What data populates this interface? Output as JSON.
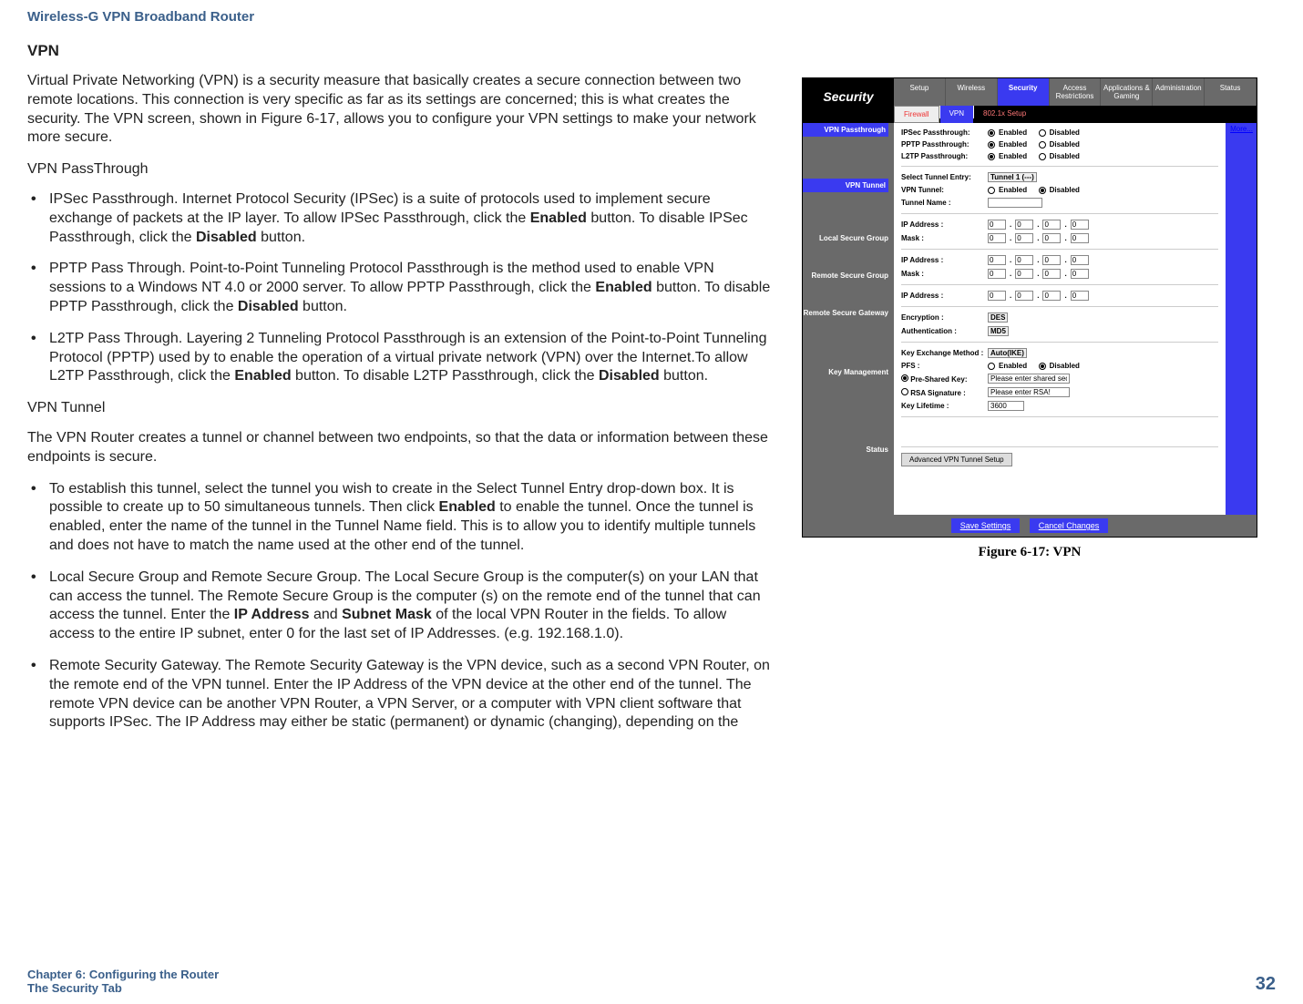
{
  "header": {
    "product": "Wireless-G VPN Broadband Router"
  },
  "section": {
    "title": "VPN"
  },
  "intro": "Virtual Private Networking (VPN) is a security measure that basically creates a secure connection between two remote locations.  This connection is very specific as far as its settings are concerned; this is what creates the security.   The VPN screen, shown in Figure 6-17, allows you to configure your VPN settings to make your network more secure.",
  "passthrough_head": "VPN PassThrough",
  "bullets_pt": [
    "IPSec Passthrough. Internet Protocol Security (IPSec) is a suite of protocols used to implement secure exchange of packets at the IP layer. To allow IPSec Passthrough, click the Enabled button. To disable IPSec Passthrough, click the Disabled button.",
    "PPTP Pass Through. Point-to-Point Tunneling Protocol Passthrough is the method used to enable VPN sessions to a Windows NT 4.0 or 2000 server. To allow PPTP Passthrough, click the Enabled button. To disable PPTP Passthrough, click the Disabled button.",
    "L2TP Pass Through. Layering 2 Tunneling Protocol Passthrough is an extension of the Point-to-Point Tunneling Protocol (PPTP) used by to enable the operation of a virtual private network (VPN) over the Internet.To allow L2TP Passthrough, click the Enabled button. To disable L2TP Passthrough, click the Disabled button."
  ],
  "tunnel_head": "VPN Tunnel",
  "tunnel_intro": "The VPN Router creates a tunnel or channel between two endpoints, so that the data or information between these endpoints is secure.",
  "bullets_tn": [
    "To establish this tunnel, select the tunnel you wish to create in the Select Tunnel Entry drop-down box.  It is possible to create up to 50 simultaneous tunnels. Then click Enabled to enable the tunnel. Once the tunnel is enabled, enter the name of the tunnel in the Tunnel Name field.  This is to allow you to identify multiple tunnels and does not have to match the name used at the other end of the tunnel.",
    "Local Secure Group and Remote Secure Group. The Local Secure Group is the computer(s) on your LAN that can access the tunnel. The Remote Secure Group is the computer (s) on the remote end of the tunnel that can access the tunnel. Enter the IP Address and Subnet Mask of the local VPN Router in the fields. To allow access to the entire IP subnet, enter 0 for the last set of IP Addresses. (e.g. 192.168.1.0).",
    "Remote Security Gateway. The Remote Security Gateway is the VPN device, such as a second VPN Router, on the remote end of the VPN tunnel. Enter the IP Address of the VPN device at the other end of the tunnel. The remote VPN device can be another VPN Router, a VPN Server, or a computer with VPN client software that supports IPSec.  The IP Address may either be static (permanent) or dynamic (changing), depending on the"
  ],
  "figure": {
    "caption": "Figure 6-17: VPN"
  },
  "ui": {
    "logo": "Security",
    "tabs": [
      "Setup",
      "Wireless",
      "Security",
      "Access Restrictions",
      "Applications & Gaming",
      "Administration",
      "Status"
    ],
    "subtabs": {
      "firewall": "Firewall",
      "vpn": "VPN",
      "dot1x": "802.1x Setup"
    },
    "side": {
      "passthrough": "VPN Passthrough",
      "tunnel": "VPN Tunnel",
      "local": "Local Secure Group",
      "remote": "Remote Secure Group",
      "gateway": "Remote Secure Gateway",
      "keymgmt": "Key Management",
      "status": "Status"
    },
    "labels": {
      "ipsec": "IPSec Passthrough:",
      "pptp": "PPTP Passthrough:",
      "l2tp": "L2TP Passthrough:",
      "enabled": "Enabled",
      "disabled": "Disabled",
      "seltunnel": "Select Tunnel Entry:",
      "seltunnel_val": "Tunnel 1 (---)",
      "vpntunnel": "VPN Tunnel:",
      "tunnelname": "Tunnel Name :",
      "ipaddr": "IP Address :",
      "mask": "Mask :",
      "encryption": "Encryption :",
      "enc_val": "DES",
      "auth": "Authentication :",
      "auth_val": "MD5",
      "kex": "Key Exchange Method :",
      "kex_val": "Auto(IKE)",
      "pfs": "PFS :",
      "psk": "Pre-Shared Key:",
      "psk_val": "Please enter shared secret!",
      "rsa": "RSA Signature :",
      "rsa_val": "Please enter RSA!",
      "klife": "Key Lifetime :",
      "klife_val": "3600",
      "more": "More...",
      "advbtn": "Advanced VPN Tunnel Setup",
      "ip0": "0"
    },
    "footer": {
      "save": "Save Settings",
      "cancel": "Cancel Changes"
    }
  },
  "footer": {
    "chapter": "Chapter 6: Configuring the Router",
    "section": "The Security Tab",
    "page": "32"
  }
}
